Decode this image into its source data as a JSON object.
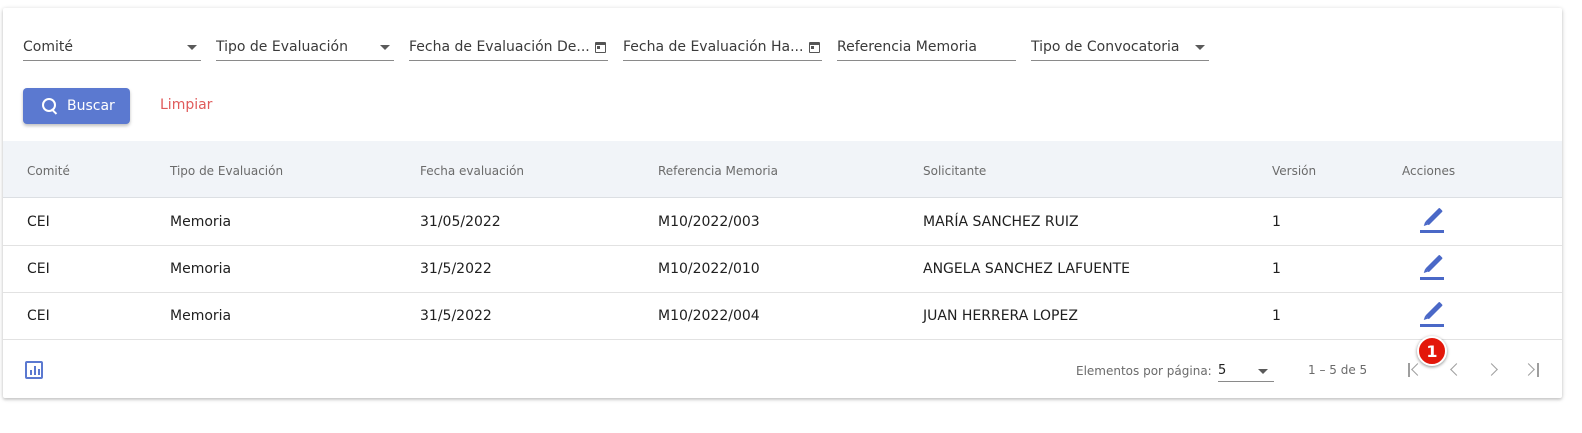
{
  "filters": {
    "comite": "Comité",
    "tipo_evaluacion": "Tipo de Evaluación",
    "fecha_desde": "Fecha de Evaluación De...",
    "fecha_hasta": "Fecha de Evaluación Ha...",
    "referencia_memoria": "Referencia Memoria",
    "tipo_convocatoria": "Tipo de Convocatoria"
  },
  "actions": {
    "buscar": "Buscar",
    "limpiar": "Limpiar"
  },
  "table": {
    "headers": {
      "comite": "Comité",
      "tipo_evaluacion": "Tipo de Evaluación",
      "fecha_evaluacion": "Fecha evaluación",
      "referencia_memoria": "Referencia Memoria",
      "solicitante": "Solicitante",
      "version": "Versión",
      "acciones": "Acciones"
    },
    "rows": [
      {
        "comite": "CEI",
        "tipo_evaluacion": "Memoria",
        "fecha_evaluacion": "31/05/2022",
        "referencia_memoria": "M10/2022/003",
        "solicitante": "MARÍA SANCHEZ RUIZ",
        "version": "1"
      },
      {
        "comite": "CEI",
        "tipo_evaluacion": "Memoria",
        "fecha_evaluacion": "31/5/2022",
        "referencia_memoria": "M10/2022/010",
        "solicitante": "ANGELA SANCHEZ LAFUENTE",
        "version": "1"
      },
      {
        "comite": "CEI",
        "tipo_evaluacion": "Memoria",
        "fecha_evaluacion": "31/5/2022",
        "referencia_memoria": "M10/2022/004",
        "solicitante": "JUAN HERRERA LOPEZ",
        "version": "1"
      }
    ]
  },
  "paginator": {
    "per_page_label": "Elementos por página:",
    "per_page_value": "5",
    "range": "1 – 5 de 5"
  },
  "badge": {
    "number": "1",
    "color": "#e3170a"
  },
  "colors": {
    "primary": "#5b79d0",
    "danger": "#e05a5a"
  },
  "icons": {
    "search": "search-icon",
    "calendar": "calendar-icon",
    "edit": "edit-icon",
    "chart": "bar-chart-icon",
    "first": "first-page-icon",
    "prev": "chevron-left-icon",
    "next": "chevron-right-icon",
    "last": "last-page-icon"
  }
}
